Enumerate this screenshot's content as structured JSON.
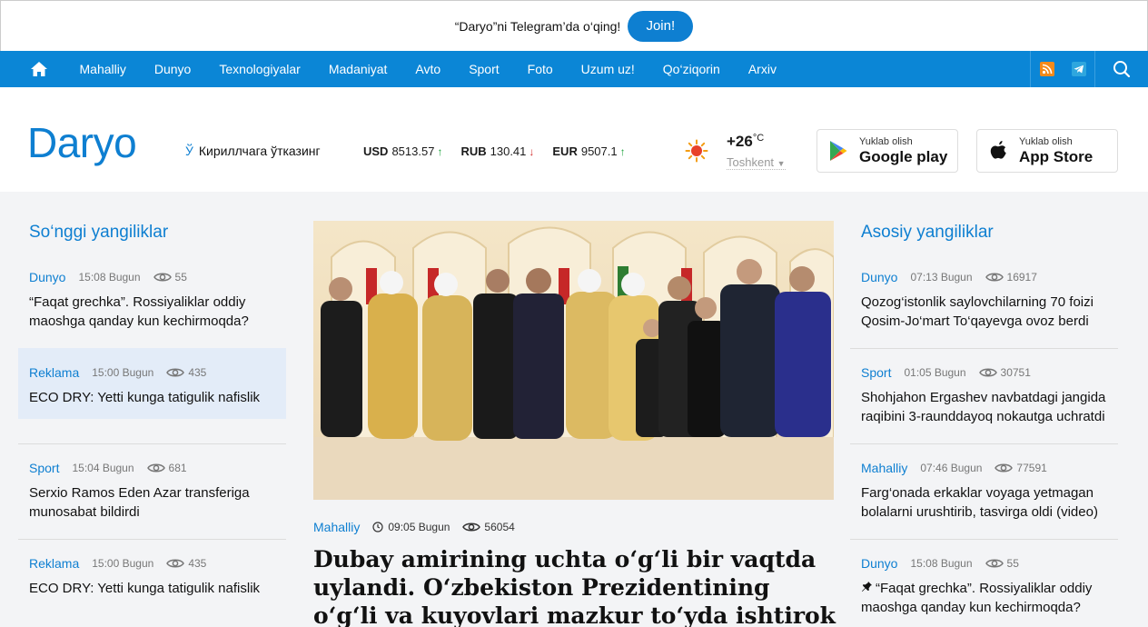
{
  "topbar": {
    "text": "“Daryo”ni Telegram’da o‘qing!",
    "join_label": "Join!"
  },
  "nav": {
    "items": [
      "Mahalliy",
      "Dunyo",
      "Texnologiyalar",
      "Madaniyat",
      "Avto",
      "Sport",
      "Foto",
      "Uzum uz!",
      "Qo‘ziqorin",
      "Arxiv"
    ],
    "icons": [
      "home-icon",
      "rss-icon",
      "telegram-icon",
      "search-icon"
    ]
  },
  "header": {
    "logo": "Daryo",
    "translit_icon": "Ў",
    "translit_label": "Кириллчага ўтказинг",
    "rates": [
      {
        "code": "USD",
        "value": "8513.57",
        "trend": "↑"
      },
      {
        "code": "RUB",
        "value": "130.41",
        "trend": "↓"
      },
      {
        "code": "EUR",
        "value": "9507.1",
        "trend": "↑"
      }
    ],
    "weather": {
      "temp": "+26",
      "unit": "°C",
      "city": "Toshkent"
    },
    "google": {
      "small": "Yuklab olish",
      "big": "Google play"
    },
    "apple": {
      "small": "Yuklab olish",
      "big": "App Store"
    }
  },
  "latest": {
    "title": "So‘nggi yangiliklar",
    "items": [
      {
        "cat": "Dunyo",
        "time": "15:08 Bugun",
        "views": "55",
        "text": "“Faqat grechka”. Rossiyaliklar oddiy maoshga qanday kun kechirmoqda?"
      },
      {
        "cat": "Reklama",
        "time": "15:00 Bugun",
        "views": "435",
        "text": "ECO DRY: Yetti kunga tatigulik nafislik"
      },
      {
        "cat": "Sport",
        "time": "15:04 Bugun",
        "views": "681",
        "text": "Serxio Ramos Eden Azar transferiga munosabat bildirdi"
      },
      {
        "cat": "Reklama",
        "time": "15:00 Bugun",
        "views": "435",
        "text": "ECO DRY: Yetti kunga tatigulik nafislik"
      }
    ]
  },
  "featured": {
    "cat": "Mahalliy",
    "time": "09:05 Bugun",
    "views": "56054",
    "title": "Dubay amirining uchta o‘g‘li bir vaqtda uylandi. O‘zbekiston Prezidentining o‘g‘li va kuyovlari mazkur to‘yda ishtirok etdi"
  },
  "main_news": {
    "title": "Asosiy yangiliklar",
    "items": [
      {
        "cat": "Dunyo",
        "time": "07:13 Bugun",
        "views": "16917",
        "text": "Qozog‘istonlik saylovchilarning 70 foizi Qosim-Jo‘mart To‘qayevga ovoz berdi"
      },
      {
        "cat": "Sport",
        "time": "01:05 Bugun",
        "views": "30751",
        "text": "Shohjahon Ergashev navbatdagi jangida raqibini 3-raunddayoq nokautga uchratdi"
      },
      {
        "cat": "Mahalliy",
        "time": "07:46 Bugun",
        "views": "77591",
        "text": "Farg‘onada erkaklar voyaga yetmagan bolalarni urushtirib, tasvirga oldi (video)"
      },
      {
        "cat": "Dunyo",
        "time": "15:08 Bugun",
        "views": "55",
        "text": "“Faqat grechka”. Rossiyaliklar oddiy maoshga qanday kun kechirmoqda?",
        "pinned": true
      }
    ]
  },
  "colors": {
    "brand": "#0e7fd1",
    "nav": "#0b86d6",
    "highlight": "#e3ecf8"
  }
}
